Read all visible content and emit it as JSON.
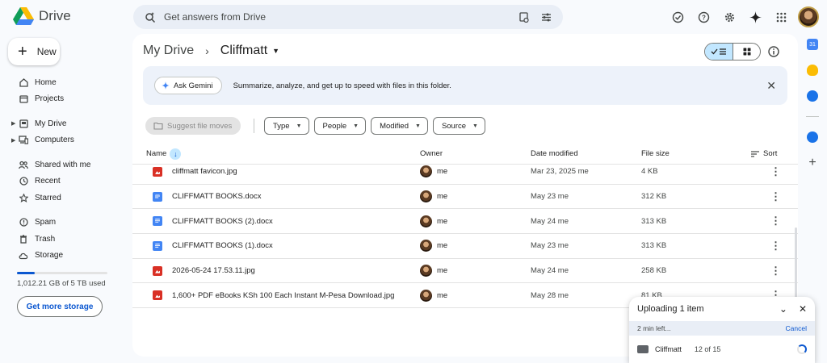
{
  "app": {
    "name": "Drive"
  },
  "search": {
    "placeholder": "Get answers from Drive"
  },
  "new_button": {
    "label": "New"
  },
  "sidebar": {
    "items": [
      {
        "label": "Home",
        "icon": "home-icon"
      },
      {
        "label": "Projects",
        "icon": "projects-icon"
      },
      {
        "label": "My Drive",
        "icon": "my-drive-icon"
      },
      {
        "label": "Computers",
        "icon": "computers-icon"
      },
      {
        "label": "Shared with me",
        "icon": "shared-icon"
      },
      {
        "label": "Recent",
        "icon": "clock-icon"
      },
      {
        "label": "Starred",
        "icon": "star-icon"
      },
      {
        "label": "Spam",
        "icon": "spam-icon"
      },
      {
        "label": "Trash",
        "icon": "trash-icon"
      },
      {
        "label": "Storage",
        "icon": "cloud-icon"
      }
    ],
    "storage_used_fraction": 0.2,
    "storage_text": "1,012.21 GB of 5 TB used",
    "get_storage_label": "Get more storage"
  },
  "breadcrumb": {
    "root": "My Drive",
    "current": "Cliffmatt"
  },
  "gemini": {
    "button_label": "Ask Gemini",
    "text": "Summarize, analyze, and get up to speed with files in this folder."
  },
  "filters": {
    "suggest_label": "Suggest file moves",
    "chips": [
      "Type",
      "People",
      "Modified",
      "Source"
    ]
  },
  "table": {
    "headers": {
      "name": "Name",
      "owner": "Owner",
      "modified": "Date modified",
      "size": "File size",
      "sort": "Sort"
    },
    "rows": [
      {
        "type": "img",
        "name": "cliffmatt favicon.jpg",
        "owner": "me",
        "modified": "Mar 23, 2025 me",
        "size": "4 KB"
      },
      {
        "type": "doc",
        "name": "CLIFFMATT BOOKS.docx",
        "owner": "me",
        "modified": "May 23 me",
        "size": "312 KB"
      },
      {
        "type": "doc",
        "name": "CLIFFMATT BOOKS (2).docx",
        "owner": "me",
        "modified": "May 24 me",
        "size": "313 KB"
      },
      {
        "type": "doc",
        "name": "CLIFFMATT BOOKS (1).docx",
        "owner": "me",
        "modified": "May 23 me",
        "size": "313 KB"
      },
      {
        "type": "img",
        "name": "2026-05-24 17.53.11.jpg",
        "owner": "me",
        "modified": "May 24 me",
        "size": "258 KB"
      },
      {
        "type": "img",
        "name": "1,600+ PDF eBooks KSh 100 Each Instant M-Pesa Download.jpg",
        "owner": "me",
        "modified": "May 28 me",
        "size": "81 KB"
      }
    ]
  },
  "upload": {
    "title": "Uploading 1 item",
    "status": "2 min left...",
    "cancel": "Cancel",
    "item_name": "Cliffmatt",
    "item_count": "12 of 15"
  },
  "rail": {
    "calendar_label": "31"
  }
}
